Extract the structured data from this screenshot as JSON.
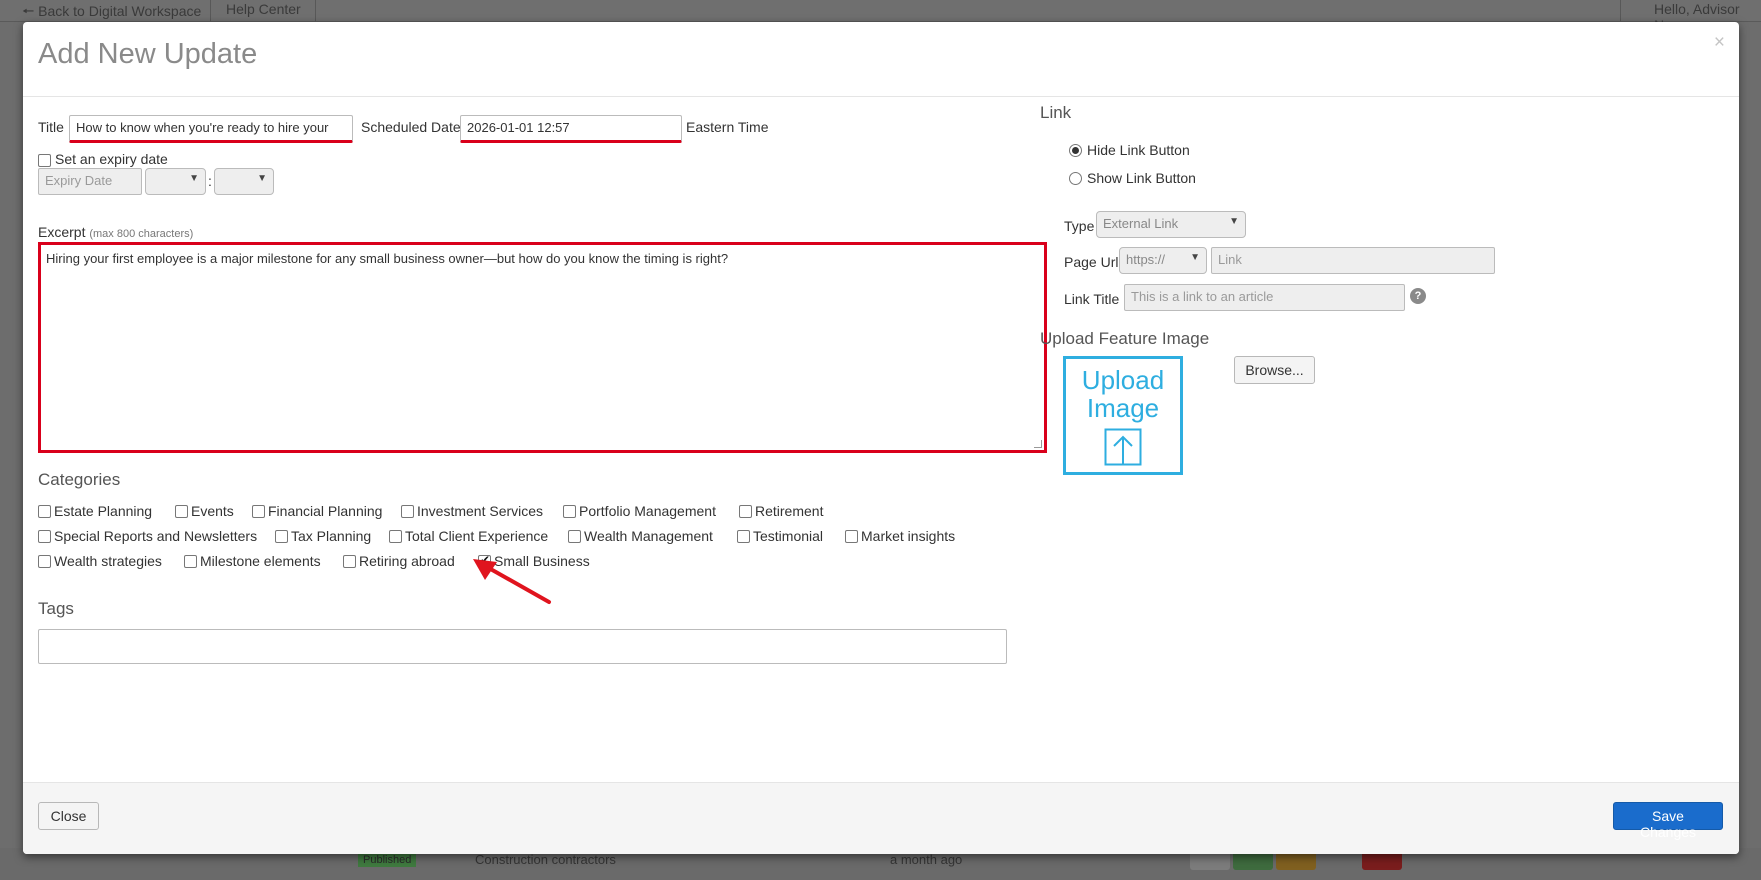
{
  "background": {
    "back_link": "🠔 Back to Digital Workspace",
    "help_center": "Help Center",
    "greeting": "Hello, Advisor Na",
    "row_badge": "Published",
    "row_name": "Construction contractors",
    "row_time": "a month ago"
  },
  "modal": {
    "title": "Add New Update",
    "close_symbol": "×"
  },
  "form": {
    "title_label": "Title",
    "title_value": "How to know when you're ready to hire your",
    "scheduled_label": "Scheduled Date",
    "scheduled_value": "2026-01-01 12:57",
    "timezone": "Eastern Time",
    "expiry_checkbox_label": "Set an expiry date",
    "expiry_placeholder": "Expiry Date",
    "time_colon": ":",
    "excerpt_label": "Excerpt",
    "excerpt_hint": "(max 800 characters)",
    "excerpt_value": "Hiring your first employee is a major milestone for any small business owner—but how do you know the timing is right?"
  },
  "categories": {
    "heading": "Categories",
    "items": [
      {
        "label": "Estate Planning",
        "checked": false
      },
      {
        "label": "Events",
        "checked": false
      },
      {
        "label": "Financial Planning",
        "checked": false
      },
      {
        "label": "Investment Services",
        "checked": false
      },
      {
        "label": "Portfolio Management",
        "checked": false
      },
      {
        "label": "Retirement",
        "checked": false
      },
      {
        "label": "Special Reports and Newsletters",
        "checked": false
      },
      {
        "label": "Tax Planning",
        "checked": false
      },
      {
        "label": "Total Client Experience",
        "checked": false
      },
      {
        "label": "Wealth Management",
        "checked": false
      },
      {
        "label": "Testimonial",
        "checked": false
      },
      {
        "label": "Market insights",
        "checked": false
      },
      {
        "label": "Wealth strategies",
        "checked": false
      },
      {
        "label": "Milestone elements",
        "checked": false
      },
      {
        "label": "Retiring abroad",
        "checked": false
      },
      {
        "label": "Small Business",
        "checked": true
      }
    ]
  },
  "tags": {
    "heading": "Tags",
    "value": ""
  },
  "link": {
    "heading": "Link",
    "hide_option": "Hide Link Button",
    "show_option": "Show Link Button",
    "selected": "Hide Link Button",
    "type_label": "Type",
    "type_value": "External Link",
    "page_url_label": "Page Url",
    "protocol_value": "https://",
    "url_placeholder": "Link",
    "link_title_label": "Link Title",
    "link_title_placeholder": "This is a link to an article",
    "help_symbol": "?"
  },
  "upload": {
    "heading": "Upload Feature Image",
    "box_line1": "Upload",
    "box_line2": "Image",
    "browse_label": "Browse..."
  },
  "footer": {
    "close_label": "Close",
    "save_label": "Save Changes"
  },
  "colors": {
    "primary": "#1a6ccc",
    "highlight_red": "#d9001b",
    "upload_blue": "#2eaee0"
  }
}
